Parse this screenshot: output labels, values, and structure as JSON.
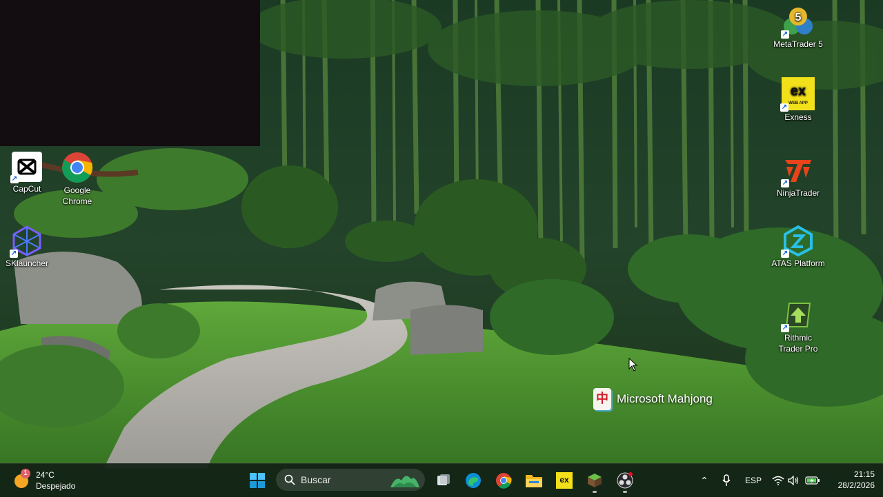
{
  "desktop": {
    "left_icons": [
      {
        "label": "CapCut",
        "icon": "capcut-icon"
      },
      {
        "label": "Google Chrome",
        "icon": "chrome-icon"
      },
      {
        "label": "SKlauncher",
        "icon": "sklauncher-icon"
      }
    ],
    "right_icons": [
      {
        "label": "MetaTrader 5",
        "icon": "metatrader-icon"
      },
      {
        "label": "Exness",
        "icon": "exness-icon",
        "sub": "WEB APP"
      },
      {
        "label": "NinjaTrader",
        "icon": "ninjatrader-icon"
      },
      {
        "label": "ATAS Platform",
        "icon": "atas-icon"
      },
      {
        "label": "Rithmic Trader Pro",
        "icon": "rithmic-icon"
      }
    ],
    "widget": {
      "label": "Microsoft Mahjong",
      "icon": "mahjong-icon",
      "glyph": "中"
    }
  },
  "taskbar": {
    "weather": {
      "temp": "24°C",
      "condition": "Despejado",
      "badge": "1"
    },
    "search_placeholder": "Buscar",
    "pinned": [
      "task-view-icon",
      "edge-icon",
      "chrome-icon",
      "file-explorer-icon",
      "exness-icon",
      "minecraft-icon",
      "obs-icon"
    ],
    "tray": {
      "language": "ESP",
      "time": "21:15",
      "date": "28/2/2026"
    }
  },
  "colors": {
    "accent": "#1e9bd7",
    "exness_yellow": "#f2e01b",
    "ninja_orange": "#e8431b",
    "atas_cyan": "#29c0e6",
    "rithmic_green": "#7dc142"
  }
}
